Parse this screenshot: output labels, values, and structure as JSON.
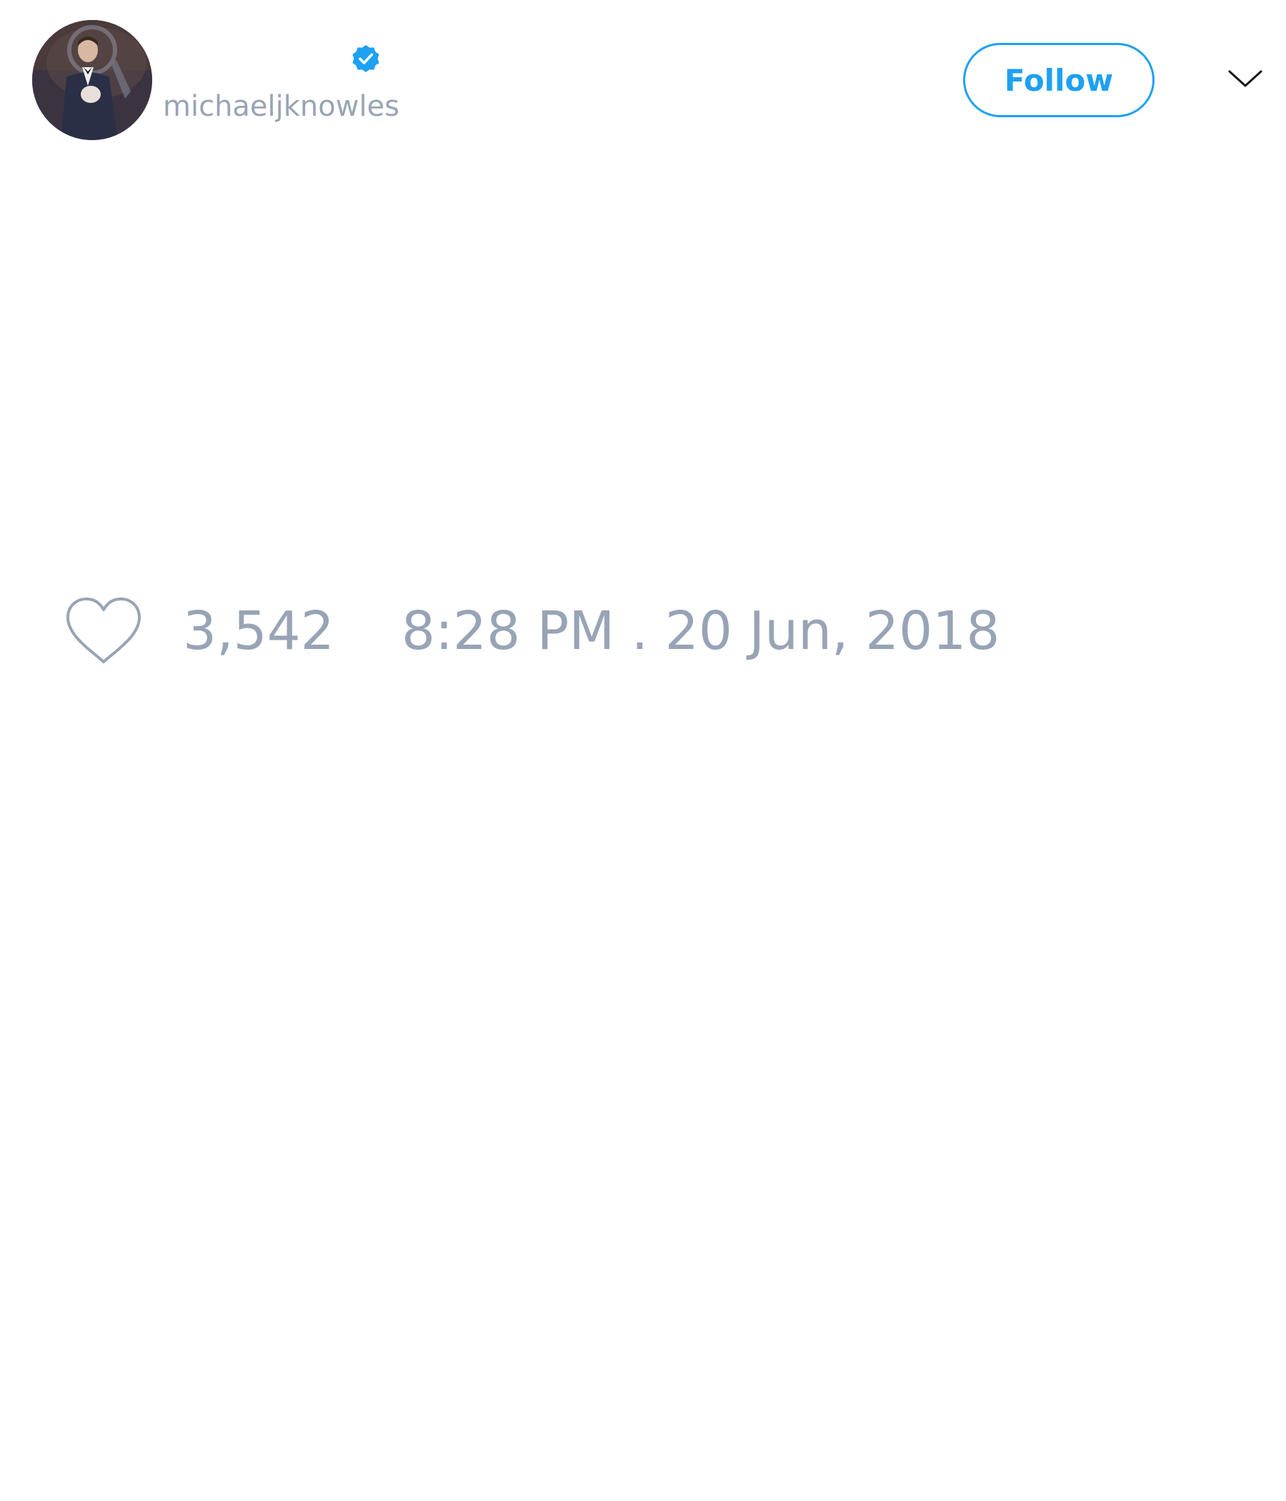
{
  "user": {
    "handle": "michaeljknowles",
    "verified": true
  },
  "header": {
    "follow_label": "Follow"
  },
  "tweet": {
    "like_count": "3,542",
    "timestamp": "8:28 PM . 20 Jun, 2018"
  },
  "icons": {
    "verified": "verified-badge-icon",
    "chevron": "chevron-down-icon",
    "like": "heart-icon"
  },
  "colors": {
    "accent": "#1da1f2",
    "muted_text": "#98a4b6",
    "background": "#ffffff"
  }
}
